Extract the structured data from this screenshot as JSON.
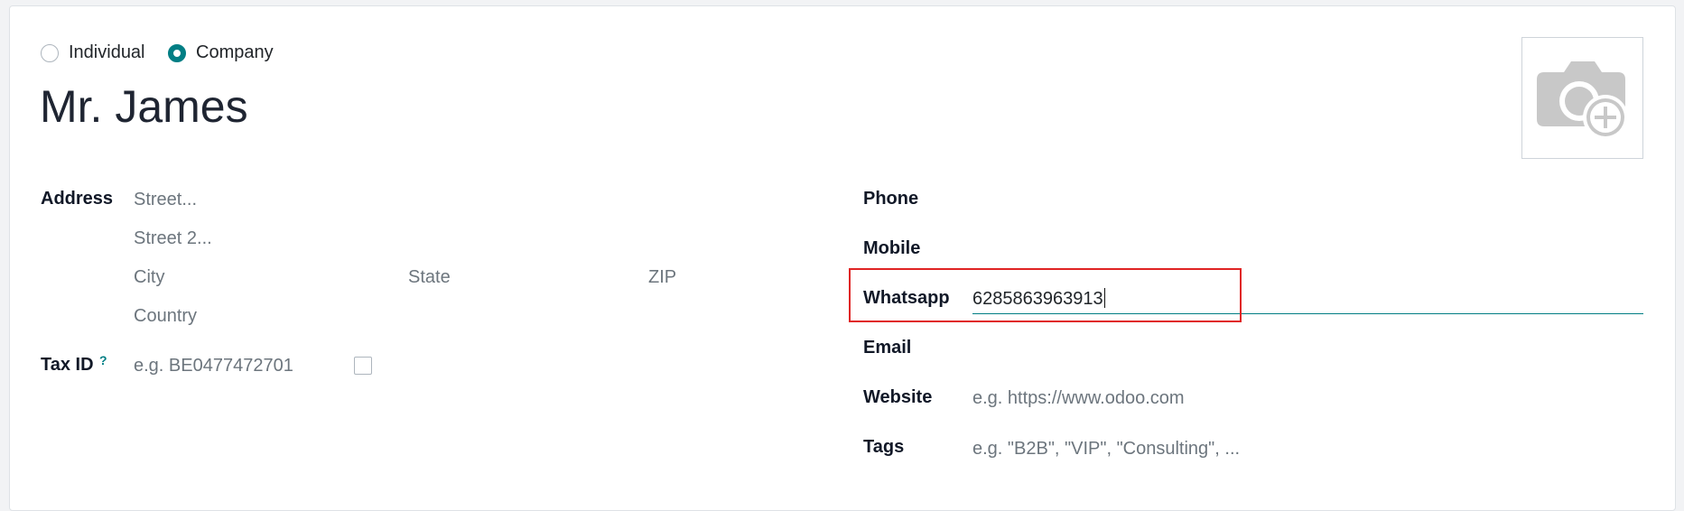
{
  "company_type": {
    "options": [
      {
        "label": "Individual",
        "checked": false
      },
      {
        "label": "Company",
        "checked": true
      }
    ]
  },
  "partner": {
    "name": "Mr. James"
  },
  "avatar": {
    "icon": "camera-plus-icon"
  },
  "address": {
    "label": "Address",
    "street_placeholder": "Street...",
    "street2_placeholder": "Street 2...",
    "city_placeholder": "City",
    "state_placeholder": "State",
    "zip_placeholder": "ZIP",
    "country_placeholder": "Country"
  },
  "tax": {
    "label": "Tax ID",
    "help": "?",
    "placeholder": "e.g. BE0477472701"
  },
  "contact": {
    "phone_label": "Phone",
    "mobile_label": "Mobile",
    "whatsapp_label": "Whatsapp",
    "whatsapp_value": "6285863963913",
    "email_label": "Email",
    "website_label": "Website",
    "website_placeholder": "e.g. https://www.odoo.com",
    "tags_label": "Tags",
    "tags_placeholder": "e.g. \"B2B\", \"VIP\", \"Consulting\", ..."
  },
  "colors": {
    "accent": "#017e84",
    "highlight": "#e02424"
  }
}
